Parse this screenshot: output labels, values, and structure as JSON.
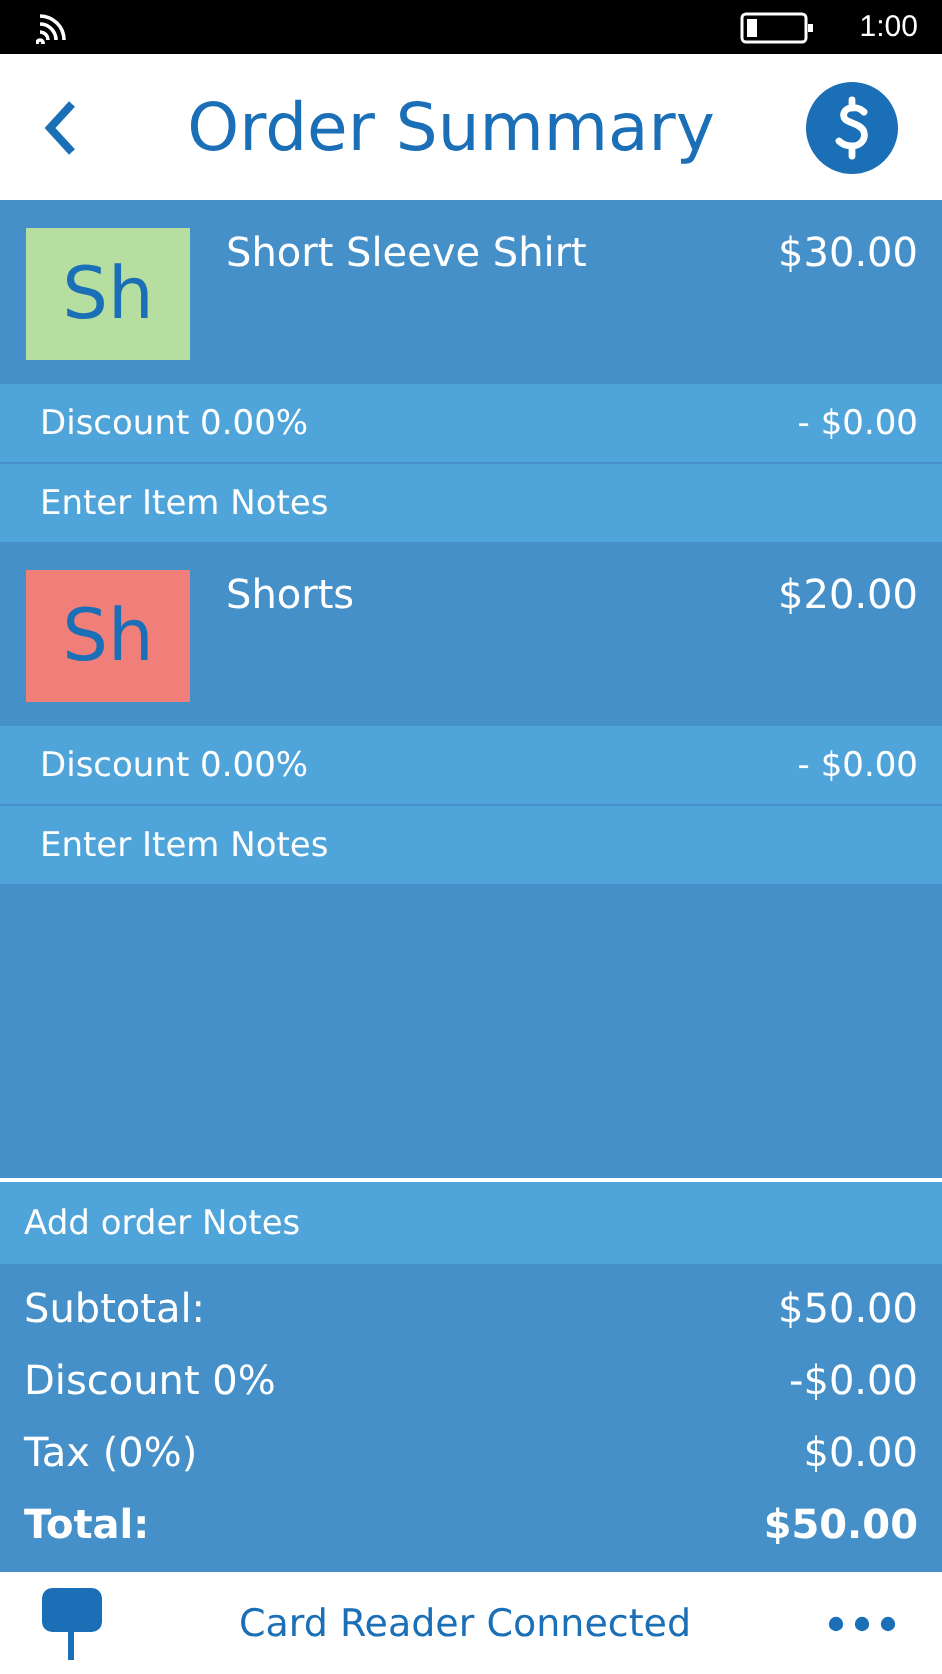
{
  "status_bar": {
    "time": "1:00"
  },
  "header": {
    "title": "Order Summary"
  },
  "items": [
    {
      "initials": "Sh",
      "color": "#b5dea0",
      "name": "Short Sleeve Shirt",
      "price": "$30.00",
      "discount_label": "Discount 0.00%",
      "discount_amount": "- $0.00",
      "notes_placeholder": "Enter Item Notes"
    },
    {
      "initials": "Sh",
      "color": "#f07f7a",
      "name": "Shorts",
      "price": "$20.00",
      "discount_label": "Discount 0.00%",
      "discount_amount": "- $0.00",
      "notes_placeholder": "Enter Item Notes"
    }
  ],
  "order_notes": {
    "placeholder": "Add order Notes"
  },
  "totals": [
    {
      "kind": "line",
      "label": "Subtotal:",
      "value": "$50.00"
    },
    {
      "kind": "line",
      "label": "Discount 0%",
      "value": "-$0.00"
    },
    {
      "kind": "line",
      "label": "Tax (0%)",
      "value": "$0.00"
    },
    {
      "kind": "total",
      "label": "Total:",
      "value": "$50.00"
    }
  ],
  "footer": {
    "status": "Card Reader Connected"
  }
}
